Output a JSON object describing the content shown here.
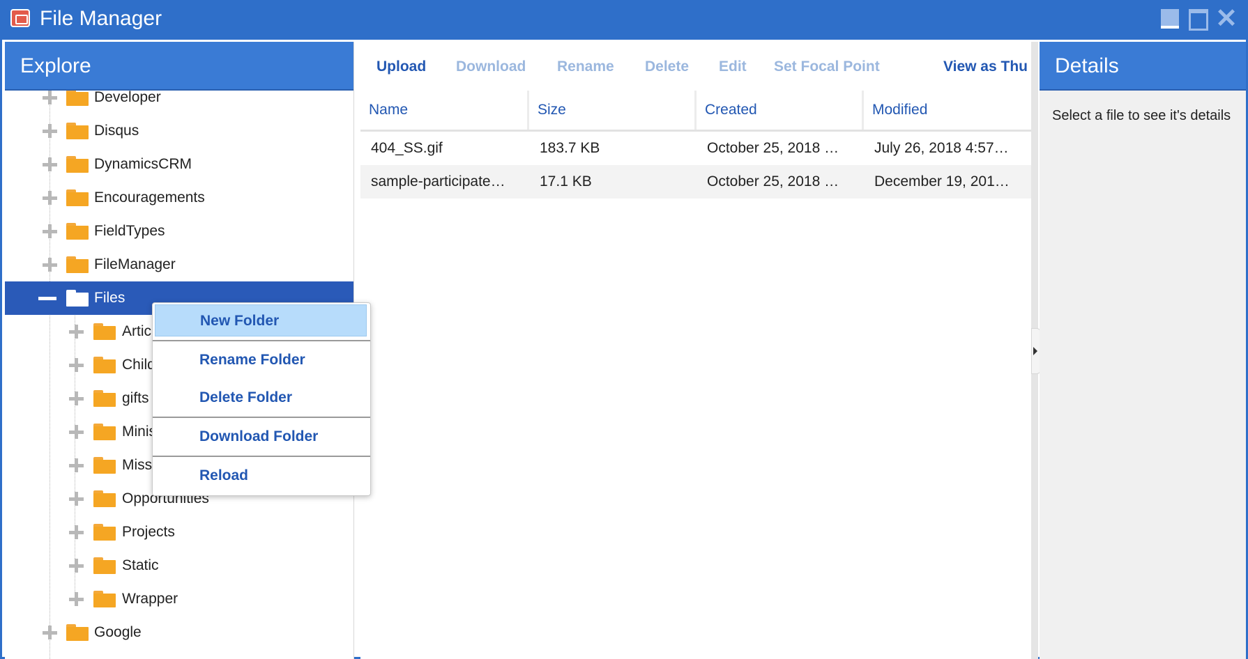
{
  "window": {
    "title": "File Manager",
    "icon": "file-manager-icon",
    "controls": [
      "minimize-icon",
      "maximize-icon",
      "close-icon"
    ]
  },
  "explore": {
    "header": "Explore",
    "items": [
      {
        "label": "Developer",
        "level": 0,
        "state": "collapsed"
      },
      {
        "label": "Disqus",
        "level": 0,
        "state": "collapsed"
      },
      {
        "label": "DynamicsCRM",
        "level": 0,
        "state": "collapsed"
      },
      {
        "label": "Encouragements",
        "level": 0,
        "state": "collapsed"
      },
      {
        "label": "FieldTypes",
        "level": 0,
        "state": "collapsed"
      },
      {
        "label": "FileManager",
        "level": 0,
        "state": "collapsed"
      },
      {
        "label": "Files",
        "level": 0,
        "state": "expanded",
        "selected": true
      },
      {
        "label": "Artic",
        "level": 1,
        "state": "collapsed"
      },
      {
        "label": "Child",
        "level": 1,
        "state": "collapsed"
      },
      {
        "label": "gifts",
        "level": 1,
        "state": "collapsed"
      },
      {
        "label": "Minis",
        "level": 1,
        "state": "collapsed"
      },
      {
        "label": "Miss",
        "level": 1,
        "state": "collapsed"
      },
      {
        "label": "Opportunities",
        "level": 1,
        "state": "collapsed"
      },
      {
        "label": "Projects",
        "level": 1,
        "state": "collapsed"
      },
      {
        "label": "Static",
        "level": 1,
        "state": "collapsed"
      },
      {
        "label": "Wrapper",
        "level": 1,
        "state": "collapsed"
      },
      {
        "label": "Google",
        "level": 0,
        "state": "collapsed"
      }
    ]
  },
  "toolbar": {
    "upload": "Upload",
    "download": "Download",
    "rename": "Rename",
    "delete": "Delete",
    "edit": "Edit",
    "focal": "Set Focal Point",
    "view": "View as Thu"
  },
  "grid": {
    "columns": [
      "Name",
      "Size",
      "Created",
      "Modified"
    ],
    "rows": [
      [
        "404_SS.gif",
        "183.7 KB",
        "October 25, 2018 …",
        "July 26, 2018 4:57…"
      ],
      [
        "sample-participate…",
        "17.1 KB",
        "October 25, 2018 …",
        "December 19, 201…"
      ]
    ]
  },
  "details": {
    "header": "Details",
    "text": "Select a file to see it's details"
  },
  "context_menu": {
    "new_folder": "New Folder",
    "rename_folder": "Rename Folder",
    "delete_folder": "Delete Folder",
    "download_folder": "Download Folder",
    "reload": "Reload"
  },
  "colors": {
    "titlebar": "#2f6fc9",
    "pane_header": "#3a7bd5",
    "selected_row": "#2a5ab8",
    "link": "#2257b2",
    "folder": "#f5a623",
    "menu_highlight": "#b7dcfb"
  }
}
